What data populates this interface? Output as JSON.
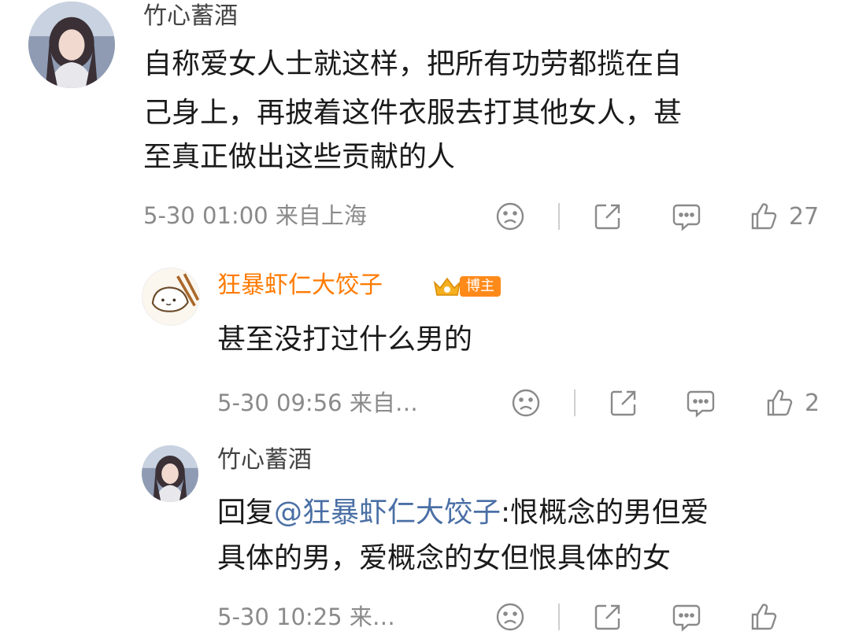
{
  "comments": [
    {
      "author": "竹心蓄酒",
      "text_lines": [
        "自称爱女人士就这样，把所有功劳都揽在自",
        "己身上，再披着这件衣服去打其他女人，甚",
        "至真正做出这些贡献的人"
      ],
      "meta": "5-30 01:00 来自上海",
      "likes": "27"
    },
    {
      "author": "狂暴虾仁大饺子",
      "badge": "博主",
      "text_lines": [
        "甚至没打过什么男的"
      ],
      "meta": "5-30 09:56 来自…",
      "likes": "2"
    },
    {
      "author": "竹心蓄酒",
      "reply_prefix": "回复",
      "mention": "@狂暴虾仁大饺子",
      "reply_rest": ":恨概念的男但爱",
      "text_lines": [
        "具体的男，爱概念的女但恨具体的女"
      ],
      "meta": "5-30 10:25 来…"
    }
  ],
  "icons": {
    "dislike": "sad-face-icon",
    "share": "share-icon",
    "comment": "comment-icon",
    "like": "thumbs-up-icon",
    "crown": "crown-icon"
  },
  "colors": {
    "accent_orange": "#ff7a00",
    "mention_blue": "#4a6fa5",
    "meta_gray": "#8a8a8a"
  }
}
